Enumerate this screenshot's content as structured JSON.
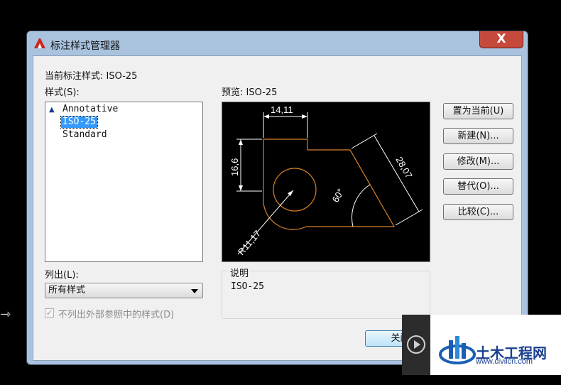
{
  "window": {
    "title": "标注样式管理器",
    "close_symbol": "X"
  },
  "current_style_label": "当前标注样式: ISO-25",
  "styles_label": "样式(S):",
  "styles": [
    "Annotative",
    "ISO-25",
    "Standard"
  ],
  "selected_style": "ISO-25",
  "list_label": "列出(L):",
  "list_value": "所有样式",
  "checkbox_label": "不列出外部参照中的样式(D)",
  "checkbox_checked": true,
  "preview_label": "预览: ISO-25",
  "preview_dims": {
    "top": "14,11",
    "left": "16,6",
    "right": "28,07",
    "angle": "60°",
    "radius": "R11,17"
  },
  "description_label": "说明",
  "description_value": "ISO-25",
  "buttons": {
    "set_current": "置为当前(U)",
    "new": "新建(N)...",
    "modify": "修改(M)...",
    "override": "替代(O)...",
    "compare": "比较(C)...",
    "close": "关闭"
  },
  "watermark": {
    "brand": "土木工程网",
    "url": "www.civilcn.com"
  },
  "colors": {
    "selection": "#3399ff",
    "preview_bg": "#000000",
    "outline_orange": "#d9822b",
    "dim_white": "#ffffff",
    "brand_blue": "#1a5fb4"
  }
}
